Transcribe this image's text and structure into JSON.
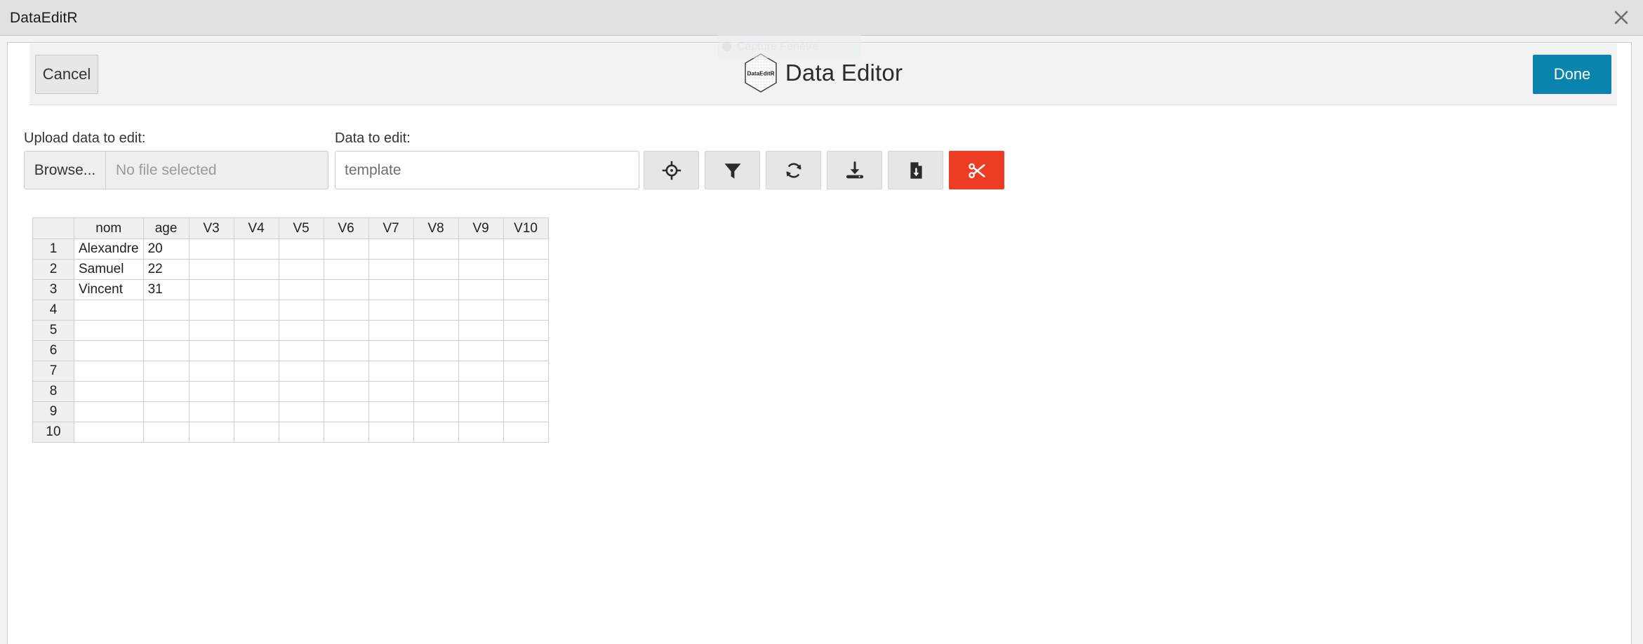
{
  "window": {
    "title": "DataEditR",
    "close_icon": "close-icon"
  },
  "capture_overlay": {
    "label": "Capture Fenêtre"
  },
  "header": {
    "cancel_label": "Cancel",
    "done_label": "Done",
    "app_title": "Data Editor",
    "logo_text": "DataEditR",
    "done_color": "#0a84ad"
  },
  "form": {
    "upload_label": "Upload data to edit:",
    "browse_label": "Browse...",
    "file_placeholder": "No file selected",
    "data_label": "Data to edit:",
    "data_value": "template",
    "data_placeholder": "template"
  },
  "toolbar": {
    "buttons": [
      {
        "name": "select-icon",
        "title": "Select"
      },
      {
        "name": "filter-icon",
        "title": "Filter"
      },
      {
        "name": "sync-icon",
        "title": "Sync"
      },
      {
        "name": "save-icon",
        "title": "Save"
      },
      {
        "name": "file-download-icon",
        "title": "Export"
      },
      {
        "name": "scissors-icon",
        "title": "Cut"
      }
    ],
    "active_color": "#ee3b24"
  },
  "table": {
    "columns": [
      "nom",
      "age",
      "V3",
      "V4",
      "V5",
      "V6",
      "V7",
      "V8",
      "V9",
      "V10"
    ],
    "row_numbers": [
      "1",
      "2",
      "3",
      "4",
      "5",
      "6",
      "7",
      "8",
      "9",
      "10"
    ],
    "rows": [
      [
        "Alexandre",
        "20",
        "",
        "",
        "",
        "",
        "",
        "",
        "",
        ""
      ],
      [
        "Samuel",
        "22",
        "",
        "",
        "",
        "",
        "",
        "",
        "",
        ""
      ],
      [
        "Vincent",
        "31",
        "",
        "",
        "",
        "",
        "",
        "",
        "",
        ""
      ],
      [
        "",
        "",
        "",
        "",
        "",
        "",
        "",
        "",
        "",
        ""
      ],
      [
        "",
        "",
        "",
        "",
        "",
        "",
        "",
        "",
        "",
        ""
      ],
      [
        "",
        "",
        "",
        "",
        "",
        "",
        "",
        "",
        "",
        ""
      ],
      [
        "",
        "",
        "",
        "",
        "",
        "",
        "",
        "",
        "",
        ""
      ],
      [
        "",
        "",
        "",
        "",
        "",
        "",
        "",
        "",
        "",
        ""
      ],
      [
        "",
        "",
        "",
        "",
        "",
        "",
        "",
        "",
        "",
        ""
      ],
      [
        "",
        "",
        "",
        "",
        "",
        "",
        "",
        "",
        "",
        ""
      ]
    ]
  }
}
